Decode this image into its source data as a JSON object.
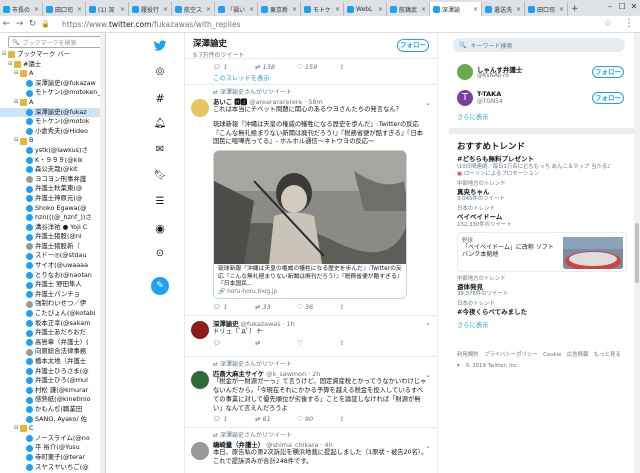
{
  "browser": {
    "tabs": [
      "市長の",
      "田口司",
      "(1) 深",
      "履役行",
      "航空ス",
      "「福い",
      "東京新",
      "モトケ",
      "WebL",
      "航鶏武",
      "深澤諭",
      "遺送洗",
      "田口司"
    ],
    "active_tab": 10,
    "url_host": "twitter.com",
    "url_path": "/fukazawas/with_replies",
    "url_prefix": "https://www.",
    "win_controls": [
      "–",
      "☐",
      "✕"
    ]
  },
  "bookmarks": {
    "search_placeholder": "ブックマークを検索",
    "items": [
      {
        "t": "ブックマーク バー",
        "k": "fold",
        "d": 0,
        "ex": "⊟"
      },
      {
        "t": "#議士",
        "k": "fold",
        "d": 1,
        "ex": "⊟"
      },
      {
        "t": "A",
        "k": "fold",
        "d": 2,
        "ex": "⊟"
      },
      {
        "t": "深澤諭史(@fukazaw",
        "k": "tw",
        "d": 3
      },
      {
        "t": "モトケン(@motoken_",
        "k": "tw",
        "d": 3
      },
      {
        "t": "A",
        "k": "fold",
        "d": 2,
        "ex": "⊟"
      },
      {
        "t": "深澤諭史(@fukaz",
        "k": "tw",
        "d": 3,
        "sel": true
      },
      {
        "t": "モトケン(@motok",
        "k": "tw",
        "d": 3
      },
      {
        "t": "小倉秀夫(@Hideo",
        "k": "tw",
        "d": 3
      },
      {
        "t": "B",
        "k": "fold",
        "d": 2,
        "ex": "⊟"
      },
      {
        "t": "ystk(@lawkus)さ",
        "k": "tw",
        "d": 3
      },
      {
        "t": "K・９９９(@kik",
        "k": "tw",
        "d": 3
      },
      {
        "t": "森公夫哉(@kit",
        "k": "tw",
        "d": 3
      },
      {
        "t": "ヨコヨン刑事弁護",
        "k": "pp",
        "d": 3
      },
      {
        "t": "弁護士秋葉東(@",
        "k": "tw",
        "d": 3
      },
      {
        "t": "弁護士神原元(@",
        "k": "tw",
        "d": 3
      },
      {
        "t": "Shoko Egawa(@",
        "k": "tw",
        "d": 3
      },
      {
        "t": "hzn(((@_hznf_))さ",
        "k": "tw",
        "d": 3
      },
      {
        "t": "溝谷洋祐 ● Yoji C",
        "k": "tw",
        "d": 3
      },
      {
        "t": "弁護士猪股(@ni",
        "k": "tw",
        "d": 3
      },
      {
        "t": "弁護士猪股新（",
        "k": "pp",
        "d": 3
      },
      {
        "t": "スドー◎(@stdau",
        "k": "tw",
        "d": 3
      },
      {
        "t": "サイオ(@uwaaaa",
        "k": "tw",
        "d": 3
      },
      {
        "t": "とりなお(@naotan",
        "k": "tw",
        "d": 3
      },
      {
        "t": "弁護士 野田隼人",
        "k": "tw",
        "d": 3
      },
      {
        "t": "弁護士パンチョ",
        "k": "tw",
        "d": 3
      },
      {
        "t": "強制わいせつ／伊",
        "k": "pp",
        "d": 3
      },
      {
        "t": "こたびょん(@kotabi",
        "k": "tw",
        "d": 3
      },
      {
        "t": "坂本正幸(@sakam",
        "k": "tw",
        "d": 3
      },
      {
        "t": "弁護士あだちおだ",
        "k": "tw",
        "d": 3
      },
      {
        "t": "高島章（弁護士）(",
        "k": "tw",
        "d": 3
      },
      {
        "t": "向原総合法律事務",
        "k": "pp",
        "d": 3
      },
      {
        "t": "橋本太地（弁護士",
        "k": "tw",
        "d": 3
      },
      {
        "t": "弁護士ひろさま(@",
        "k": "tw",
        "d": 3
      },
      {
        "t": "弁護士ひろ(@mul",
        "k": "tw",
        "d": 3
      },
      {
        "t": "村松 謙(@kmurar",
        "k": "tw",
        "d": 3
      },
      {
        "t": "感熱紙(@kinetinio",
        "k": "tw",
        "d": 3
      },
      {
        "t": "かもんぢ(職業田",
        "k": "tw",
        "d": 3
      },
      {
        "t": "SANO, Ayako/ 佐",
        "k": "tw",
        "d": 3
      },
      {
        "t": "C",
        "k": "fold",
        "d": 2,
        "ex": "⊟"
      },
      {
        "t": "ノースライム(@no",
        "k": "tw",
        "d": 3
      },
      {
        "t": "平 裕介(@Yusu",
        "k": "tw",
        "d": 3
      },
      {
        "t": "寺町東子(@terar",
        "k": "tw",
        "d": 3
      },
      {
        "t": "スヤスヤいちご(@",
        "k": "tw",
        "d": 3
      }
    ]
  },
  "profile": {
    "name": "深澤諭史",
    "count": "9.7万件のツイート",
    "follow": "フォロー"
  },
  "feed": {
    "a1": {
      "reply": "1",
      "rt": "138",
      "like": "159",
      "share": "⇧"
    },
    "thread_link": "このスレッドを表示",
    "t1": {
      "rt": "深澤諭史さんがリツイート",
      "name": "あいこ 🅷🅹",
      "handle": "@arearararerere · 58m",
      "text": "これは本当にチベット問題に関心のあるウヨさんたちの発言なん？",
      "quote": "琉球新報『沖縄は天皇の権威の犠牲になる歴史を歩んだ』:Twitterの反応『こんな無礼極まりない新聞は廃刊だろう!』『税務省便が酷すぎる』『日本国民に喧嘩売ってる』- ホルホル通信～ネトウヨの反応～",
      "card_text": "琉球新報『沖縄は天皇の権威の犠牲になる歴史を歩んだ』:Twitterの反応『こんな無礼極まりない新聞は廃刊だろう!』『税務省便が酷すぎる』『日本国民...",
      "card_domain": "horu-horu.blog.jp",
      "actions": {
        "reply": "1",
        "rt": "33",
        "like": "36",
        "share": "⇧"
      }
    },
    "t2": {
      "name": "深澤諭史",
      "handle": "@fukazawas · 1h",
      "text": "ドリュ〔ﾟдﾟ〕 ﾔｰ",
      "actions": {
        "reply": "",
        "rt": "",
        "like": "",
        "share": "⇧"
      }
    },
    "t3": {
      "rt": "深澤諭史さんがリツイート",
      "name": "匹斎大麻主サイケ",
      "handle": "@k_sawmon · 2h",
      "text": "「税金が一財源ガーっ」て言うけど、固定資産税とかってうなかいわけじゃないんだから。「今現在それにかかる予算を越える税金を投入しているすべての事業に対して優先順位が劣後する」ことを論証しなければ「財源が無い」なんて言えんだろうよ",
      "actions": {
        "reply": "1",
        "rt": "61",
        "like": "90",
        "share": "⇧"
      }
    },
    "t4": {
      "rt": "深澤諭史さんがリツイート",
      "name": "嶋崎量（弁護士）",
      "handle": "@shima_chikara · 4h",
      "text": "本日、原告私の第2次訴訟を横浜地裁に提起しました（1原状・被告20名）。これで提訴済みが合計248件です。"
    }
  },
  "right": {
    "search_placeholder": "キーワード検索",
    "suggest": [
      {
        "name": "しゃんす弁護士",
        "handle": "@KsNAb76",
        "btn": "フォロー",
        "color": "#6aa84f"
      },
      {
        "name": "T-TAKA",
        "handle": "@TGN54",
        "btn": "フォロー",
        "color": "#7b3fa0"
      }
    ],
    "more": "さらに表示",
    "trends_title": "おすすめトレンド",
    "promo": {
      "tag": "#どちらも無料プレゼント",
      "desc": "\\10日間連続／毎日1万名にどちもっち あんこ＆ホップ 当たる♪",
      "by": "ローソンによるプロモーション"
    },
    "trends": [
      {
        "ctx": "中部地方のトレンド",
        "title": "真央ちゃん",
        "count": "3,045件のツイート"
      },
      {
        "ctx": "日本のトレンド",
        "title": "ベイベイドーム",
        "count": "132,330件のツイート"
      }
    ],
    "card": {
      "ctx": "野球",
      "text": "「ベイベイドーム」に改称 ソフトバンク本拠地"
    },
    "trends2": [
      {
        "ctx": "中部地方のトレンド",
        "title": "遠体発見",
        "count": "39,378件のツイート"
      },
      {
        "ctx": "日本のトレンド",
        "title": "#今夜くらべてみました",
        "count": ""
      }
    ],
    "footer": "利用規約　プライバシーポリシー　Cookie　広告情報　もっと見る ▾　© 2019 Twitter, Inc."
  }
}
